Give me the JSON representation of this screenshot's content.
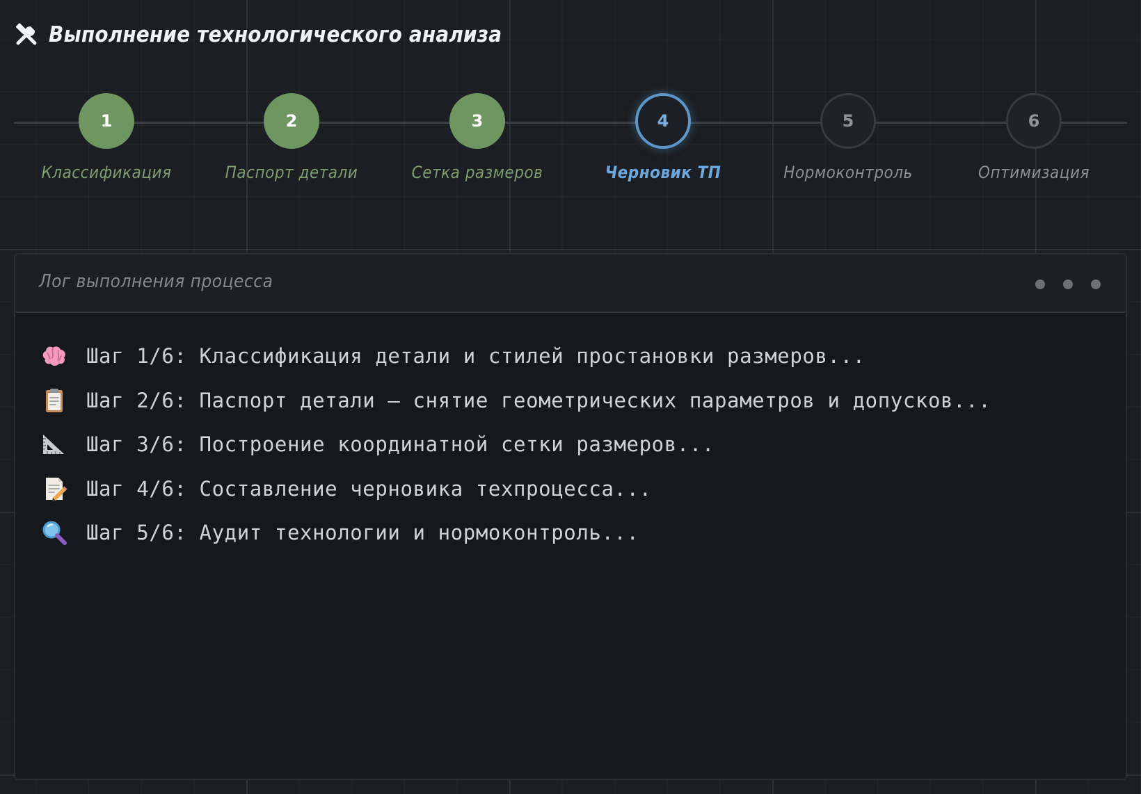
{
  "header": {
    "icon": "hammer-wrench-icon",
    "title": "Выполнение технологического анализа"
  },
  "stepper": {
    "steps": [
      {
        "number": "1",
        "label": "Классификация",
        "status": "done"
      },
      {
        "number": "2",
        "label": "Паспорт детали",
        "status": "done"
      },
      {
        "number": "3",
        "label": "Сетка размеров",
        "status": "done"
      },
      {
        "number": "4",
        "label": "Черновик ТП",
        "status": "active"
      },
      {
        "number": "5",
        "label": "Нормоконтроль",
        "status": "pending"
      },
      {
        "number": "6",
        "label": "Оптимизация",
        "status": "pending"
      }
    ]
  },
  "log": {
    "title": "Лог выполнения процесса",
    "lines": [
      {
        "icon": "brain-icon",
        "text": "Шаг 1/6: Классификация детали и стилей простановки размеров..."
      },
      {
        "icon": "clipboard-icon",
        "text": "Шаг 2/6: Паспорт детали — снятие геометрических параметров и допусков..."
      },
      {
        "icon": "triangle-ruler-icon",
        "text": "Шаг 3/6: Построение координатной сетки размеров..."
      },
      {
        "icon": "memo-icon",
        "text": "Шаг 4/6: Составление черновика техпроцесса..."
      },
      {
        "icon": "magnifier-icon",
        "text": "Шаг 5/6: Аудит технологии и нормоконтроль..."
      }
    ]
  },
  "colors": {
    "done": "#6f9660",
    "active": "#5d96c8",
    "pending": "#363b42",
    "background": "#1b1e22",
    "panel": "#15181c"
  }
}
